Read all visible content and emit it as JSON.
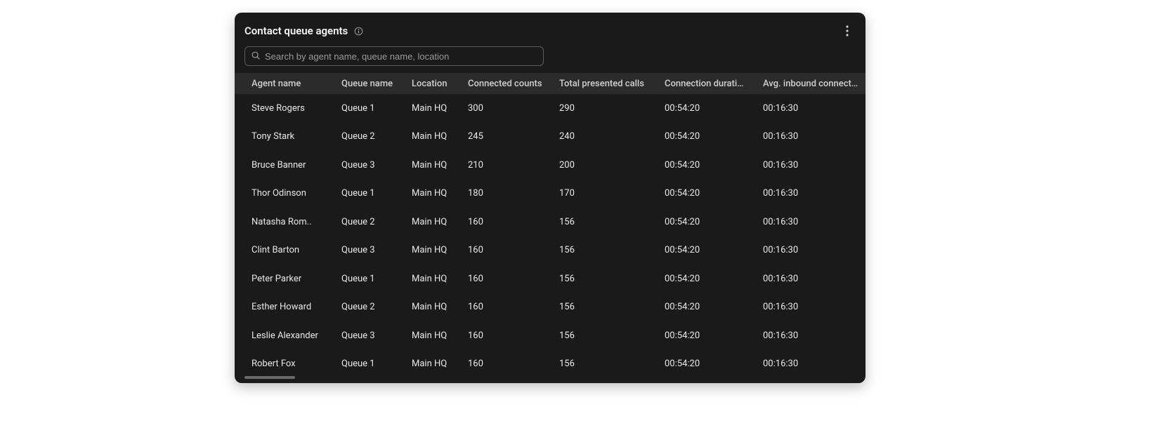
{
  "header": {
    "title": "Contact queue agents"
  },
  "search": {
    "placeholder": "Search by agent name, queue name, location"
  },
  "columns": [
    "Agent name",
    "Queue name",
    "Location",
    "Connected counts",
    "Total presented calls",
    "Connection duration",
    "Avg. inbound connect ti"
  ],
  "rows": [
    {
      "agent": "Steve Rogers",
      "queue": "Queue 1",
      "location": "Main HQ",
      "connected": "300",
      "presented": "290",
      "duration": "00:54:20",
      "avg": "00:16:30"
    },
    {
      "agent": "Tony Stark",
      "queue": "Queue 2",
      "location": "Main HQ",
      "connected": "245",
      "presented": "240",
      "duration": "00:54:20",
      "avg": "00:16:30"
    },
    {
      "agent": "Bruce Banner",
      "queue": "Queue 3",
      "location": "Main HQ",
      "connected": "210",
      "presented": "200",
      "duration": "00:54:20",
      "avg": "00:16:30"
    },
    {
      "agent": "Thor Odinson",
      "queue": "Queue 1",
      "location": "Main HQ",
      "connected": "180",
      "presented": "170",
      "duration": "00:54:20",
      "avg": "00:16:30"
    },
    {
      "agent": "Natasha Rom..",
      "queue": "Queue 2",
      "location": "Main HQ",
      "connected": "160",
      "presented": "156",
      "duration": "00:54:20",
      "avg": "00:16:30"
    },
    {
      "agent": "Clint Barton",
      "queue": "Queue 3",
      "location": "Main HQ",
      "connected": "160",
      "presented": "156",
      "duration": "00:54:20",
      "avg": "00:16:30"
    },
    {
      "agent": "Peter Parker",
      "queue": "Queue 1",
      "location": "Main HQ",
      "connected": "160",
      "presented": "156",
      "duration": "00:54:20",
      "avg": "00:16:30"
    },
    {
      "agent": "Esther Howard",
      "queue": "Queue 2",
      "location": "Main HQ",
      "connected": "160",
      "presented": "156",
      "duration": "00:54:20",
      "avg": "00:16:30"
    },
    {
      "agent": "Leslie Alexander",
      "queue": "Queue 3",
      "location": "Main HQ",
      "connected": "160",
      "presented": "156",
      "duration": "00:54:20",
      "avg": "00:16:30"
    },
    {
      "agent": "Robert Fox",
      "queue": "Queue 1",
      "location": "Main HQ",
      "connected": "160",
      "presented": "156",
      "duration": "00:54:20",
      "avg": "00:16:30"
    }
  ]
}
